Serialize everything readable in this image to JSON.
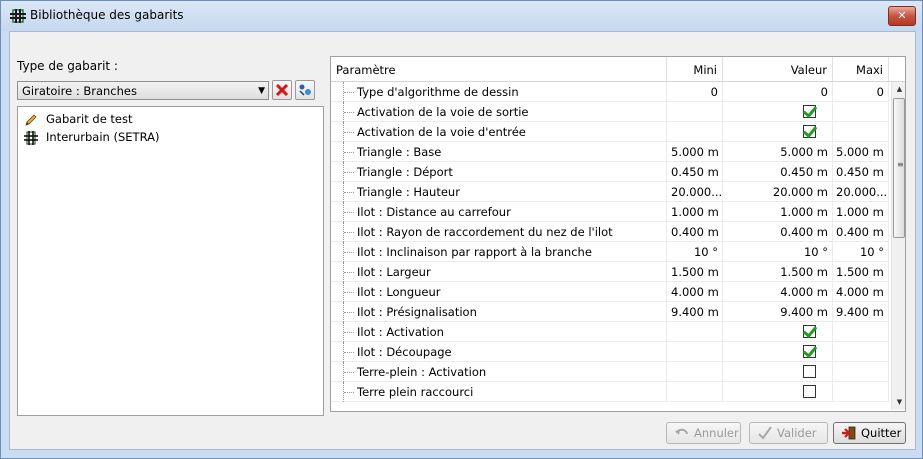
{
  "window": {
    "title": "Bibliothèque des gabarits",
    "close_label": "✕"
  },
  "left_panel": {
    "type_label": "Type de gabarit :",
    "combo_value": "Giratoire : Branches",
    "items": [
      {
        "label": "Gabarit de test",
        "icon": "pencil-icon"
      },
      {
        "label": "Interurbain (SETRA)",
        "icon": "grid-cross-icon"
      }
    ]
  },
  "grid": {
    "columns": {
      "param": "Paramètre",
      "mini": "Mini",
      "valeur": "Valeur",
      "maxi": "Maxi"
    },
    "rows": [
      {
        "name": "Type d'algorithme de dessin",
        "mini": "0",
        "valeur": "0",
        "maxi": "0",
        "kind": "num"
      },
      {
        "name": "Activation de la voie de sortie",
        "mini": "",
        "valeur": true,
        "maxi": "",
        "kind": "check"
      },
      {
        "name": "Activation de la voie d'entrée",
        "mini": "",
        "valeur": true,
        "maxi": "",
        "kind": "check"
      },
      {
        "name": "Triangle : Base",
        "mini": "5.000 m",
        "valeur": "5.000 m",
        "maxi": "5.000 m",
        "kind": "text"
      },
      {
        "name": "Triangle : Déport",
        "mini": "0.450 m",
        "valeur": "0.450 m",
        "maxi": "0.450 m",
        "kind": "text"
      },
      {
        "name": "Triangle : Hauteur",
        "mini": "20.000...",
        "valeur": "20.000 m",
        "maxi": "20.000...",
        "kind": "text"
      },
      {
        "name": "Ilot : Distance au carrefour",
        "mini": "1.000 m",
        "valeur": "1.000 m",
        "maxi": "1.000 m",
        "kind": "text"
      },
      {
        "name": "Ilot : Rayon de raccordement du nez de l'ilot",
        "mini": "0.400 m",
        "valeur": "0.400 m",
        "maxi": "0.400 m",
        "kind": "text"
      },
      {
        "name": "Ilot : Inclinaison par rapport à la branche",
        "mini": "10 °",
        "valeur": "10 °",
        "maxi": "10 °",
        "kind": "num"
      },
      {
        "name": "Ilot : Largeur",
        "mini": "1.500 m",
        "valeur": "1.500 m",
        "maxi": "1.500 m",
        "kind": "text"
      },
      {
        "name": "Ilot : Longueur",
        "mini": "4.000 m",
        "valeur": "4.000 m",
        "maxi": "4.000 m",
        "kind": "text"
      },
      {
        "name": "Ilot : Présignalisation",
        "mini": "9.400 m",
        "valeur": "9.400 m",
        "maxi": "9.400 m",
        "kind": "text"
      },
      {
        "name": "Ilot : Activation",
        "mini": "",
        "valeur": true,
        "maxi": "",
        "kind": "check"
      },
      {
        "name": "Ilot : Découpage",
        "mini": "",
        "valeur": true,
        "maxi": "",
        "kind": "check"
      },
      {
        "name": "Terre-plein : Activation",
        "mini": "",
        "valeur": false,
        "maxi": "",
        "kind": "check"
      },
      {
        "name": "Terre plein raccourci",
        "mini": "",
        "valeur": false,
        "maxi": "",
        "kind": "check"
      }
    ]
  },
  "buttons": {
    "annuler": "Annuler",
    "valider": "Valider",
    "quitter": "Quitter"
  }
}
